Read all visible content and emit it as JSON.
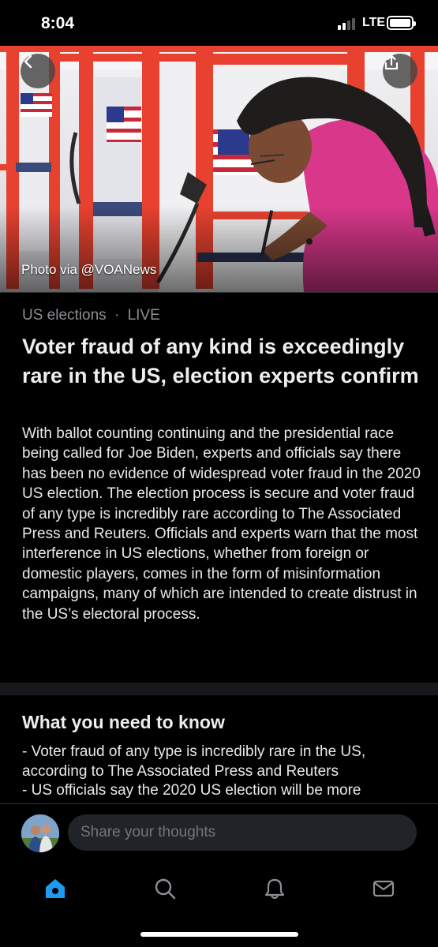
{
  "status_bar": {
    "time": "8:04",
    "network": "LTE",
    "signal_bars": 2,
    "battery_level": 1.0
  },
  "hero": {
    "credit": "Photo via @VOANews"
  },
  "article": {
    "category": "US elections",
    "separator": "·",
    "badge": "LIVE",
    "headline": "Voter fraud of any kind is exceedingly rare in the US, election experts confirm",
    "body": "With ballot counting continuing and the presidential race being called for Joe Biden, experts and officials say there has been no evidence of widespread voter fraud in the 2020 US election. The election process is secure and voter fraud of any type is incredibly rare according to The Associated Press and Reuters. Officials and experts warn that the most interference in US elections, whether from foreign or domestic players, comes in the form of misinformation campaigns, many of which are intended to create distrust in the US’s electoral process."
  },
  "need_to_know": {
    "title": "What you need to know",
    "items": [
      "- Voter fraud of any type is incredibly rare in the US, according to The Associated Press and Reuters",
      "- US officials say the 2020 US election will be more"
    ]
  },
  "composer": {
    "placeholder": "Share your thoughts"
  },
  "tabs": [
    {
      "icon": "home-icon",
      "active": true
    },
    {
      "icon": "search-icon",
      "active": false
    },
    {
      "icon": "bell-icon",
      "active": false
    },
    {
      "icon": "mail-icon",
      "active": false
    }
  ],
  "colors": {
    "accent": "#1d9bf0",
    "booth_red": "#e8412f",
    "shirt_pink": "#d9378a"
  }
}
